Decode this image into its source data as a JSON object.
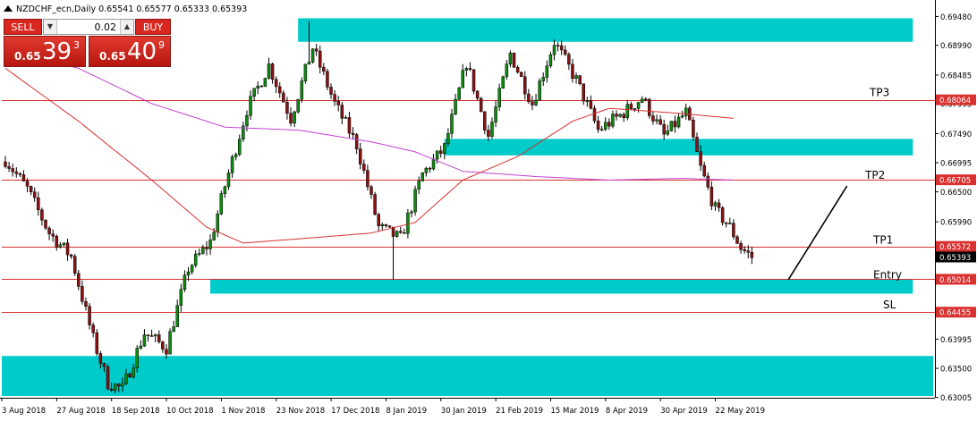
{
  "header": {
    "symbol_info": "NZDCHF_ecn,Daily  0.65541 0.65577 0.65333 0.65393"
  },
  "ticket": {
    "sell_label": "SELL",
    "buy_label": "BUY",
    "lot_value": "0.02",
    "sell_prefix": "0.65",
    "sell_big": "39",
    "sell_sup": "3",
    "buy_prefix": "0.65",
    "buy_big": "40",
    "buy_sup": "9"
  },
  "chart_data": {
    "type": "candlestick",
    "y_range": [
      0.63,
      0.697
    ],
    "y_ticks": [
      "0.69480",
      "0.68990",
      "0.68485",
      "0.67995",
      "0.67490",
      "0.66995",
      "0.66500",
      "0.65990",
      "0.65500",
      "0.64995",
      "0.64500",
      "0.63995",
      "0.63500",
      "0.63005"
    ],
    "x_ticks": [
      "3 Aug 2018",
      "27 Aug 2018",
      "18 Sep 2018",
      "10 Oct 2018",
      "1 Nov 2018",
      "23 Nov 2018",
      "17 Dec 2018",
      "8 Jan 2019",
      "30 Jan 2019",
      "21 Feb 2019",
      "15 Mar 2019",
      "8 Apr 2019",
      "30 Apr 2019",
      "22 May 2019"
    ],
    "num_bars": 205,
    "close_path": [
      {
        "i": 0,
        "v": 0.6705
      },
      {
        "i": 6,
        "v": 0.6655
      },
      {
        "i": 12,
        "v": 0.658
      },
      {
        "i": 18,
        "v": 0.654
      },
      {
        "i": 24,
        "v": 0.64
      },
      {
        "i": 28,
        "v": 0.6325
      },
      {
        "i": 32,
        "v": 0.6315
      },
      {
        "i": 38,
        "v": 0.641
      },
      {
        "i": 44,
        "v": 0.6385
      },
      {
        "i": 50,
        "v": 0.652
      },
      {
        "i": 56,
        "v": 0.6565
      },
      {
        "i": 60,
        "v": 0.666
      },
      {
        "i": 66,
        "v": 0.679
      },
      {
        "i": 72,
        "v": 0.6865
      },
      {
        "i": 78,
        "v": 0.6775
      },
      {
        "i": 84,
        "v": 0.6895
      },
      {
        "i": 90,
        "v": 0.68
      },
      {
        "i": 96,
        "v": 0.673
      },
      {
        "i": 102,
        "v": 0.659
      },
      {
        "i": 108,
        "v": 0.657
      },
      {
        "i": 114,
        "v": 0.668
      },
      {
        "i": 120,
        "v": 0.6725
      },
      {
        "i": 126,
        "v": 0.687
      },
      {
        "i": 132,
        "v": 0.6745
      },
      {
        "i": 138,
        "v": 0.6885
      },
      {
        "i": 144,
        "v": 0.68
      },
      {
        "i": 150,
        "v": 0.6905
      },
      {
        "i": 156,
        "v": 0.684
      },
      {
        "i": 162,
        "v": 0.6755
      },
      {
        "i": 168,
        "v": 0.678
      },
      {
        "i": 174,
        "v": 0.681
      },
      {
        "i": 180,
        "v": 0.6745
      },
      {
        "i": 186,
        "v": 0.6785
      },
      {
        "i": 190,
        "v": 0.669
      },
      {
        "i": 194,
        "v": 0.662
      },
      {
        "i": 198,
        "v": 0.659
      },
      {
        "i": 201,
        "v": 0.6555
      },
      {
        "i": 204,
        "v": 0.6539
      }
    ],
    "spikes": [
      {
        "i": 106,
        "high": 0.658,
        "low": 0.6501
      },
      {
        "i": 83,
        "high": 0.694,
        "low": 0.687
      }
    ],
    "ma_fast": [
      {
        "i": 0,
        "v": 0.686
      },
      {
        "i": 20,
        "v": 0.677
      },
      {
        "i": 40,
        "v": 0.667
      },
      {
        "i": 55,
        "v": 0.659
      },
      {
        "i": 65,
        "v": 0.6563
      },
      {
        "i": 80,
        "v": 0.657
      },
      {
        "i": 100,
        "v": 0.658
      },
      {
        "i": 112,
        "v": 0.6598
      },
      {
        "i": 125,
        "v": 0.667
      },
      {
        "i": 140,
        "v": 0.671
      },
      {
        "i": 155,
        "v": 0.677
      },
      {
        "i": 165,
        "v": 0.6792
      },
      {
        "i": 185,
        "v": 0.6783
      },
      {
        "i": 199,
        "v": 0.6775
      }
    ],
    "ma_slow": [
      {
        "i": 0,
        "v": 0.689
      },
      {
        "i": 20,
        "v": 0.686
      },
      {
        "i": 40,
        "v": 0.68
      },
      {
        "i": 60,
        "v": 0.676
      },
      {
        "i": 80,
        "v": 0.6755
      },
      {
        "i": 100,
        "v": 0.6735
      },
      {
        "i": 112,
        "v": 0.6718
      },
      {
        "i": 125,
        "v": 0.6685
      },
      {
        "i": 145,
        "v": 0.6676
      },
      {
        "i": 165,
        "v": 0.667
      },
      {
        "i": 185,
        "v": 0.6673
      },
      {
        "i": 199,
        "v": 0.667
      }
    ],
    "zones": [
      {
        "i0": 80,
        "i1": 248,
        "top": 0.6945,
        "bottom": 0.6905
      },
      {
        "i0": 120,
        "i1": 248,
        "top": 0.674,
        "bottom": 0.6712
      },
      {
        "i0": 56,
        "i1": 248,
        "top": 0.6501,
        "bottom": 0.6477
      },
      {
        "i0": -2,
        "i1": 260,
        "top": 0.6371,
        "bottom": 0.6303
      }
    ],
    "levels": [
      {
        "value": 0.68064,
        "label": "0.68064",
        "name": "TP3"
      },
      {
        "value": 0.66705,
        "label": "0.66705",
        "name": "TP2"
      },
      {
        "value": 0.65572,
        "label": "0.65572",
        "name": "TP1"
      },
      {
        "value": 0.65014,
        "label": "0.65014",
        "name": "Entry"
      },
      {
        "value": 0.64455,
        "label": "0.64455",
        "name": "SL"
      }
    ],
    "current_price": {
      "value": 0.65393,
      "label": "0.65393"
    },
    "projection": {
      "i0": 214,
      "v0": 0.6501,
      "i1": 230,
      "v1": 0.666
    },
    "colors": {
      "up": "#0f8a0f",
      "down": "#8a1212",
      "zone": "#00cbcb",
      "level": "#d93030",
      "ma_fast": "#d83030",
      "ma_slow": "#c040d0",
      "text": "#000000"
    }
  }
}
